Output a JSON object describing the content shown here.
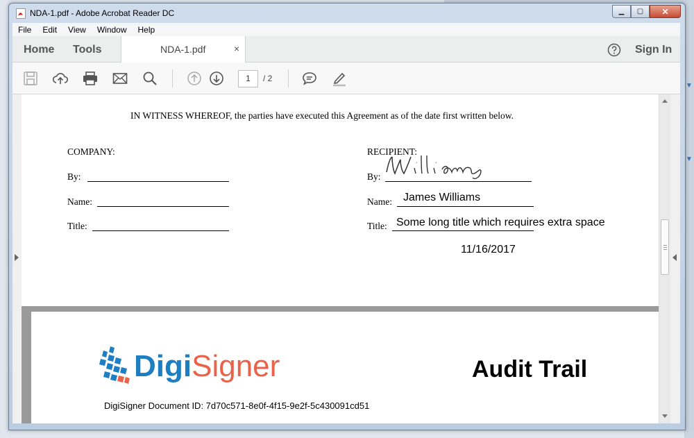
{
  "window": {
    "title": "NDA-1.pdf - Adobe Acrobat Reader DC"
  },
  "menu": [
    "File",
    "Edit",
    "View",
    "Window",
    "Help"
  ],
  "tabs": {
    "home": "Home",
    "tools": "Tools",
    "document": "NDA-1.pdf",
    "close": "×",
    "sign_in": "Sign In"
  },
  "toolbar": {
    "page_current": "1",
    "page_total": "/ 2"
  },
  "document": {
    "witness_text": "IN WITNESS WHEREOF, the parties have executed this Agreement as of the date first written below.",
    "company_heading": "COMPANY:",
    "recipient_heading": "RECIPIENT:",
    "by_label": "By:",
    "name_label": "Name:",
    "title_label": "Title:",
    "recipient_name": "James Williams",
    "recipient_title": "Some long title which requires extra space",
    "date": "11/16/2017"
  },
  "audit": {
    "logo_digi": "Digi",
    "logo_signer": "Signer",
    "heading": "Audit Trail",
    "document_id": "DigiSigner Document ID: 7d70c571-8e0f-4f15-9e2f-5c430091cd51"
  },
  "colors": {
    "logo_blue": "#1d7ec2",
    "logo_orange": "#e8634a"
  }
}
